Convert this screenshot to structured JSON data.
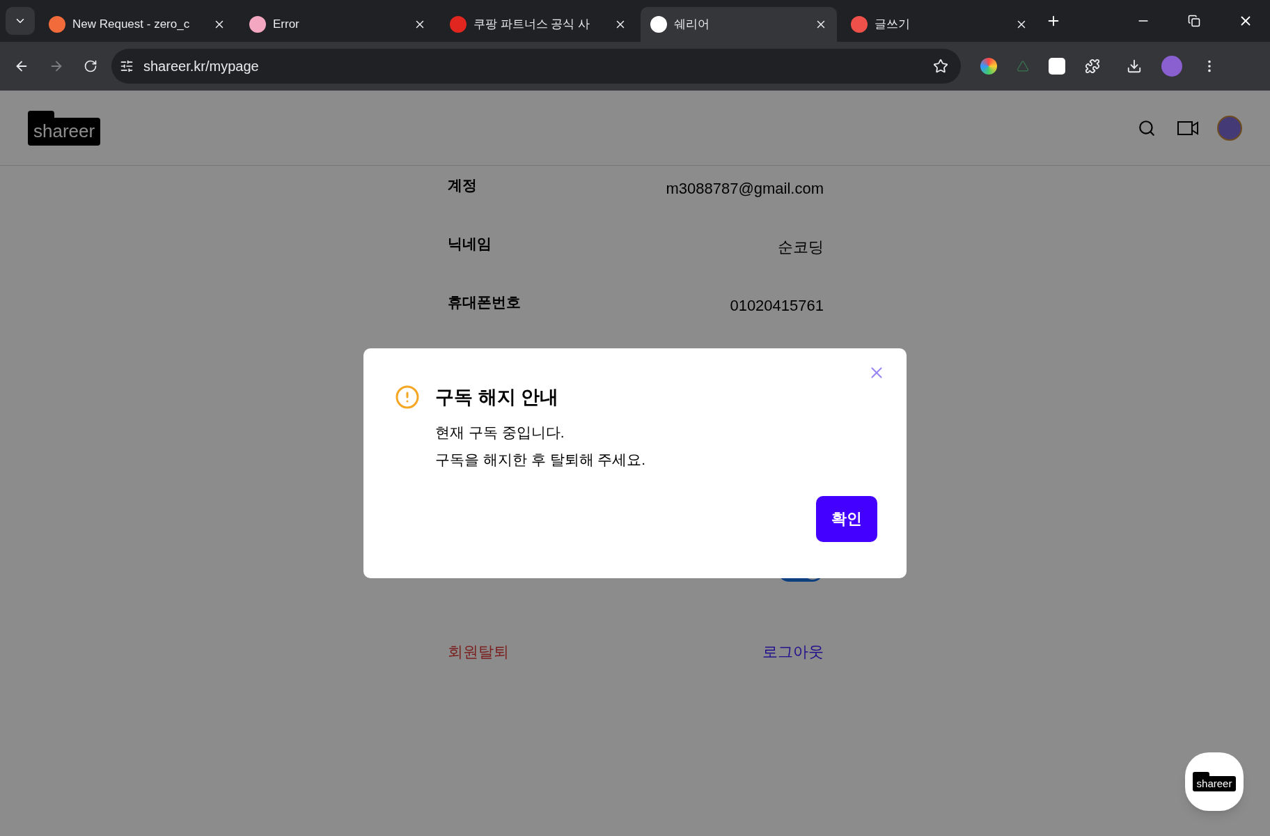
{
  "browser": {
    "tabs": [
      {
        "title": "New Request - zero_c",
        "selected": false,
        "color": "#f26b3a"
      },
      {
        "title": "Error",
        "selected": false,
        "color": "#f4a7c0"
      },
      {
        "title": "쿠팡 파트너스 공식 사",
        "selected": false,
        "color": "#e0261f"
      },
      {
        "title": "쉐리어",
        "selected": true,
        "color": "#ffffff"
      },
      {
        "title": "글쓰기",
        "selected": false,
        "color": "#f0504a"
      }
    ],
    "url": "shareer.kr/mypage"
  },
  "header": {
    "logo": "shareer"
  },
  "profile": {
    "rows": [
      {
        "label": "계정",
        "value": "m3088787@gmail.com"
      },
      {
        "label": "닉네임",
        "value": "순코딩"
      },
      {
        "label": "휴대폰번호",
        "value": "01020415761"
      }
    ],
    "toggle": {
      "on": true
    },
    "withdraw": "회원탈퇴",
    "logout": "로그아웃"
  },
  "dialog": {
    "title": "구독 해지 안내",
    "lines": [
      "현재 구독 중입니다.",
      "구독을 해지한 후 탈퇴해 주세요."
    ],
    "confirm": "확인"
  },
  "floating_button": {
    "logo": "shareer"
  }
}
